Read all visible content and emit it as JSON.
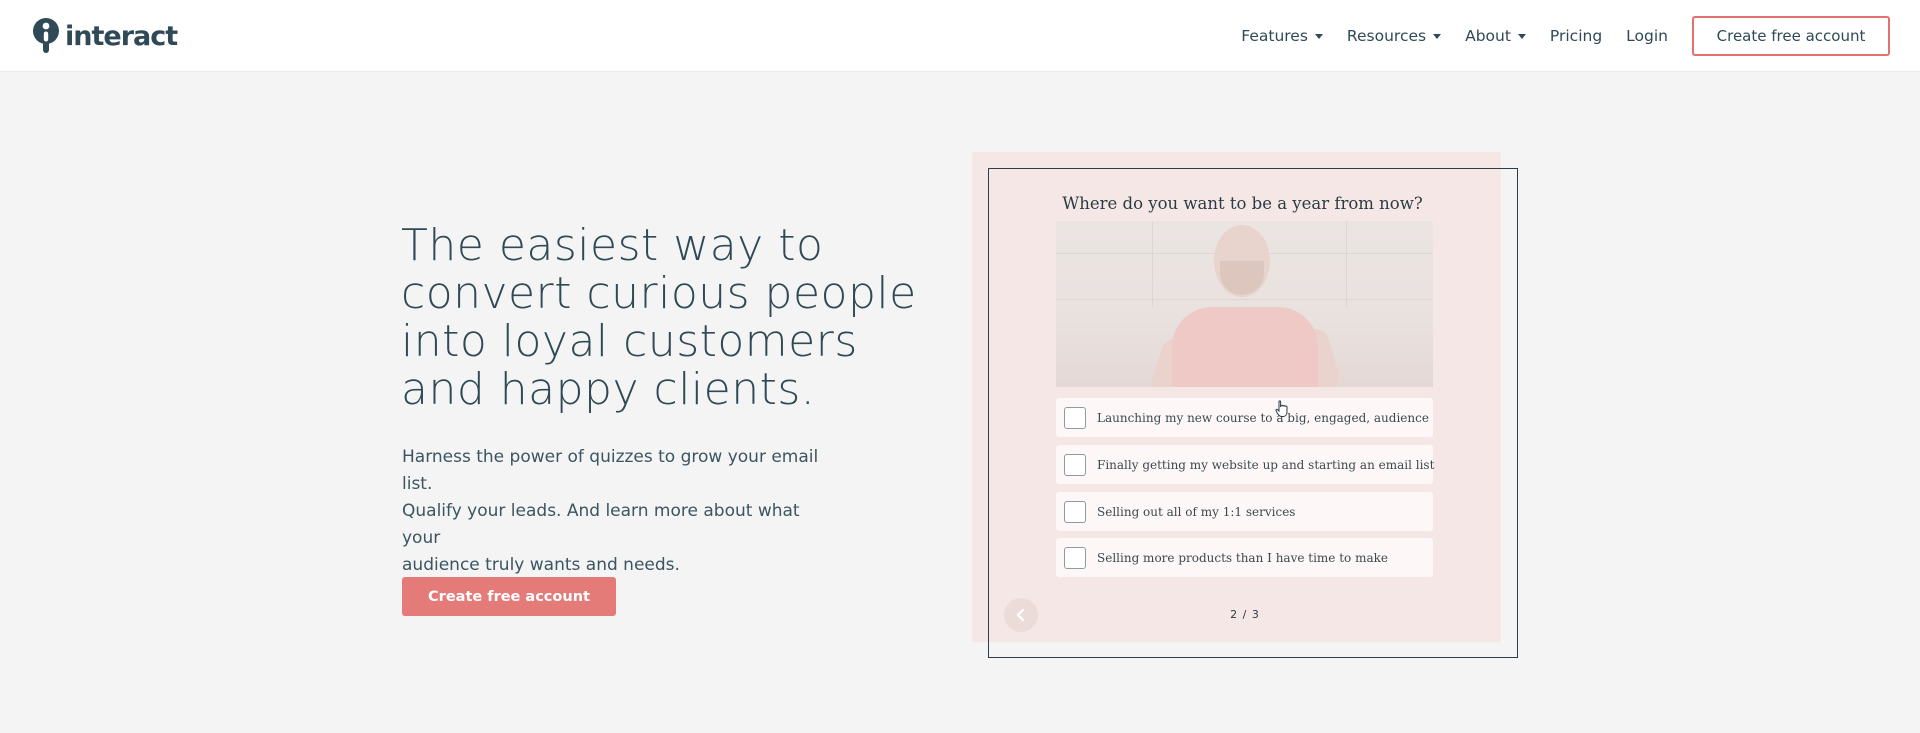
{
  "header": {
    "logo_text": "interact",
    "nav": {
      "features": "Features",
      "resources": "Resources",
      "about": "About",
      "pricing": "Pricing",
      "login": "Login",
      "cta": "Create free account"
    }
  },
  "hero": {
    "title_lines": [
      "The easiest way to",
      "convert curious people",
      "into loyal customers",
      "and happy clients."
    ],
    "subtitle_lines": [
      "Harness the power of quizzes to grow your email list.",
      "Qualify your leads. And learn more about what your",
      "audience truly wants and needs."
    ],
    "cta": "Create free account"
  },
  "quiz": {
    "question": "Where do you want to be a year from now?",
    "options": [
      "Launching my new course to a big, engaged, audience",
      "Finally getting my website up and starting an email list",
      "Selling out all of my 1:1 services",
      "Selling more products than I have time to make"
    ],
    "pager": "2 / 3"
  },
  "colors": {
    "brand_dark": "#2f4a56",
    "accent": "#e57b78",
    "page_bg": "#f3f4f3",
    "quiz_bg": "#f4e7e5"
  },
  "icons": {
    "logo": "interact-logo-mark",
    "caret": "caret-down-icon",
    "back": "chevron-left-icon",
    "cursor": "hand-cursor-icon"
  }
}
